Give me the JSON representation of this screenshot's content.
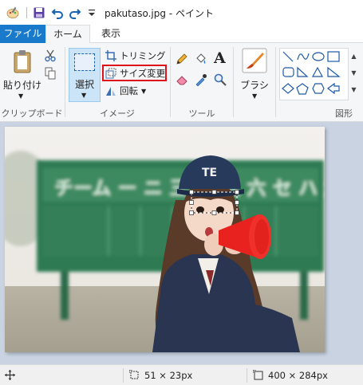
{
  "window": {
    "title": "pakutaso.jpg - ペイント"
  },
  "tabs": [
    {
      "label": "ファイル"
    },
    {
      "label": "ホーム"
    },
    {
      "label": "表示"
    }
  ],
  "clipboard": {
    "paste_label": "貼り付け",
    "group_label": "クリップボード"
  },
  "image": {
    "select_label": "選択",
    "crop_label": "トリミング",
    "resize_label": "サイズ変更",
    "rotate_label": "回転",
    "group_label": "イメージ"
  },
  "tools": {
    "group_label": "ツール",
    "text_tool_glyph": "A"
  },
  "brushes": {
    "label": "ブラシ"
  },
  "shapes": {
    "group_label": "図形"
  },
  "canvas": {
    "sign_text": "チーム ー ニ 三 四 五 六 セ ハ 九 計"
  },
  "status": {
    "selection_size": "51 × 23px",
    "image_size": "400 × 284px"
  },
  "colors": {
    "accent": "#1979ca",
    "highlight": "#e0101a",
    "workspace": "#c9d3e2"
  }
}
